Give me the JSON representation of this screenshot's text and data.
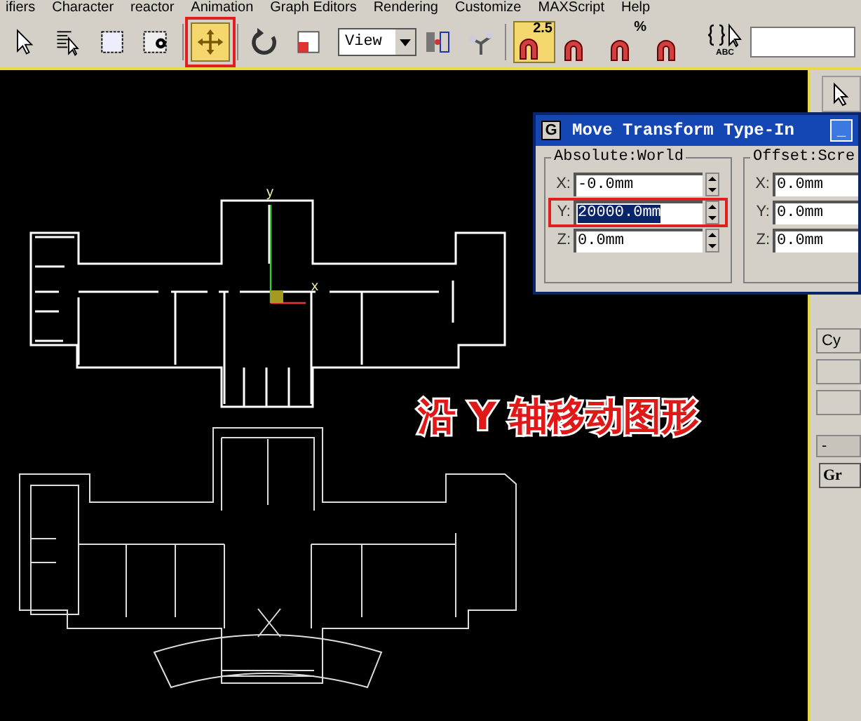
{
  "menu_bar": [
    "ifiers",
    "Character",
    "reactor",
    "Animation",
    "Graph Editors",
    "Rendering",
    "Customize",
    "MAXScript",
    "Help"
  ],
  "toolbar": {
    "buttons": [
      {
        "active": false,
        "outlined": false
      },
      {
        "active": false,
        "outlined": false
      },
      {
        "active": false,
        "outlined": false
      },
      {
        "active": false,
        "outlined": false
      },
      {
        "active": true,
        "outlined": true
      },
      {
        "active": false,
        "outlined": false
      },
      {
        "active": false,
        "outlined": false
      }
    ],
    "view_dropdown": "View",
    "snaps": [
      {
        "label": "2.5",
        "active": true
      },
      {
        "active": false
      },
      {
        "label": "%",
        "active": false
      },
      {
        "active": false
      }
    ],
    "named_selection_label": "ABC"
  },
  "viewport": {
    "gizmo_labels": [
      "y",
      "x"
    ],
    "annotation": "沿 Y 轴移动图形"
  },
  "dialog": {
    "icon_glyph": "G",
    "title": "Move Transform Type-In",
    "minimize": "_",
    "groups": [
      {
        "title": "Absolute:World",
        "fields": [
          {
            "label": "X:",
            "value": "-0.0mm",
            "selected": false,
            "outlined": false
          },
          {
            "label": "Y:",
            "value": "20000.0mm",
            "selected": true,
            "outlined": true
          },
          {
            "label": "Z:",
            "value": "0.0mm",
            "selected": false,
            "outlined": false
          }
        ]
      },
      {
        "title": "Offset:Scre",
        "fields": [
          {
            "label": "X:",
            "value": "0.0mm",
            "selected": false,
            "outlined": false
          },
          {
            "label": "Y:",
            "value": "0.0mm",
            "selected": false,
            "outlined": false
          },
          {
            "label": "Z:",
            "value": "0.0mm",
            "selected": false,
            "outlined": false
          }
        ]
      }
    ]
  },
  "command_panel": {
    "button_label": "Cy",
    "rollout_sign": "-",
    "list_label": "Gr"
  }
}
